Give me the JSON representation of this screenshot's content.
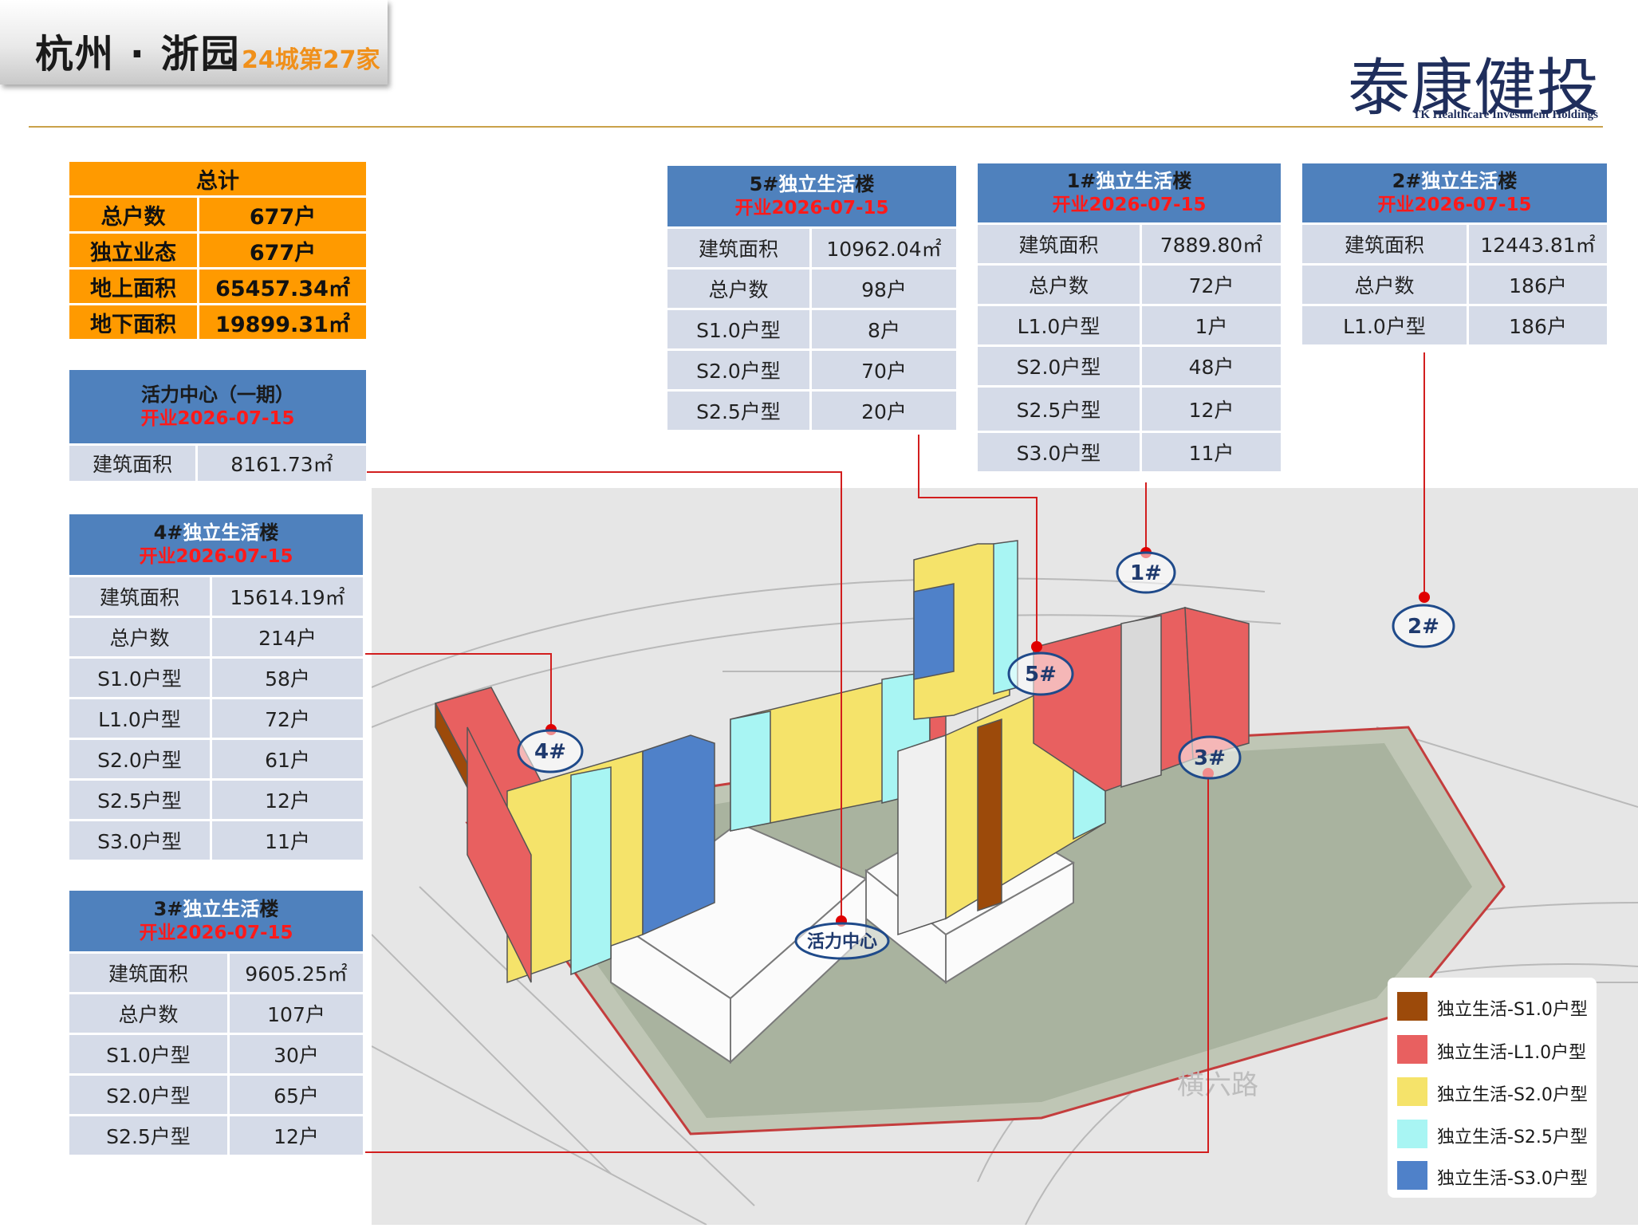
{
  "header": {
    "title": "杭州 · 浙园",
    "subtitle": "24城第27家",
    "logo_cn": "泰康健投",
    "logo_en": "TK Healthcare Investment Holdings"
  },
  "totals": {
    "title": "总计",
    "rows": [
      {
        "label": "总户数",
        "value": "677户"
      },
      {
        "label": "独立业态",
        "value": "677户"
      },
      {
        "label": "地上面积",
        "value": "65457.34㎡"
      },
      {
        "label": "地下面积",
        "value": "19899.31㎡"
      }
    ]
  },
  "vitality": {
    "title": "活力中心（一期）",
    "opening": "开业2026-07-15",
    "rows": [
      {
        "label": "建筑面积",
        "value": "8161.73㎡"
      }
    ]
  },
  "b4": {
    "title_a": "4#",
    "title_b": "独立生活",
    "title_c": "楼",
    "opening": "开业2026-07-15",
    "rows": [
      {
        "label": "建筑面积",
        "value": "15614.19㎡"
      },
      {
        "label": "总户数",
        "value": "214户"
      },
      {
        "label": "S1.0户型",
        "value": "58户"
      },
      {
        "label": "L1.0户型",
        "value": "72户"
      },
      {
        "label": "S2.0户型",
        "value": "61户"
      },
      {
        "label": "S2.5户型",
        "value": "12户"
      },
      {
        "label": "S3.0户型",
        "value": "11户"
      }
    ]
  },
  "b3": {
    "title_a": "3#",
    "title_b": "独立生活",
    "title_c": "楼",
    "opening": "开业2026-07-15",
    "rows": [
      {
        "label": "建筑面积",
        "value": "9605.25㎡"
      },
      {
        "label": "总户数",
        "value": "107户"
      },
      {
        "label": "S1.0户型",
        "value": "30户"
      },
      {
        "label": "S2.0户型",
        "value": "65户"
      },
      {
        "label": "S2.5户型",
        "value": "12户"
      }
    ]
  },
  "b5": {
    "title_a": "5#",
    "title_b": "独立生活",
    "title_c": "楼",
    "opening": "开业2026-07-15",
    "rows": [
      {
        "label": "建筑面积",
        "value": "10962.04㎡"
      },
      {
        "label": "总户数",
        "value": "98户"
      },
      {
        "label": "S1.0户型",
        "value": "8户"
      },
      {
        "label": "S2.0户型",
        "value": "70户"
      },
      {
        "label": "S2.5户型",
        "value": "20户"
      }
    ]
  },
  "b1": {
    "title_a": "1#",
    "title_b": "独立生活",
    "title_c": "楼",
    "opening": "开业2026-07-15",
    "rows": [
      {
        "label": "建筑面积",
        "value": "7889.80㎡"
      },
      {
        "label": "总户数",
        "value": "72户"
      },
      {
        "label": "L1.0户型",
        "value": "1户"
      },
      {
        "label": "S2.0户型",
        "value": "48户"
      },
      {
        "label": "S2.5户型",
        "value": "12户"
      },
      {
        "label": "S3.0户型",
        "value": "11户"
      }
    ]
  },
  "b2": {
    "title_a": "2#",
    "title_b": "独立生活",
    "title_c": "楼",
    "opening": "开业2026-07-15",
    "rows": [
      {
        "label": "建筑面积",
        "value": "12443.81㎡"
      },
      {
        "label": "总户数",
        "value": "186户"
      },
      {
        "label": "L1.0户型",
        "value": "186户"
      }
    ]
  },
  "diagram": {
    "markers": {
      "b1": "1#",
      "b2": "2#",
      "b3": "3#",
      "b4": "4#",
      "b5": "5#",
      "center": "活力中心"
    },
    "road_label": "横六路"
  },
  "legend": [
    {
      "label": "独立生活-S1.0户型",
      "color": "#9c4a0a"
    },
    {
      "label": "独立生活-L1.0户型",
      "color": "#e86060"
    },
    {
      "label": "独立生活-S2.0户型",
      "color": "#f5e36a"
    },
    {
      "label": "独立生活-S2.5户型",
      "color": "#a8f5f3"
    },
    {
      "label": "独立生活-S3.0户型",
      "color": "#4f81c9"
    }
  ],
  "colors": {
    "orange": "#ff9a00",
    "header_blue": "#4f81bd",
    "cell": "#d5dbe8",
    "leader": "#d21e1e",
    "brand_navy": "#1f2e5c"
  }
}
